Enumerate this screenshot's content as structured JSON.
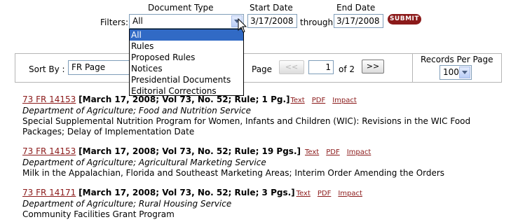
{
  "filters": {
    "label": "Filters:",
    "document_type": {
      "header": "Document Type",
      "value": "All",
      "options": [
        "All",
        "Rules",
        "Proposed Rules",
        "Notices",
        "Presidential Documents",
        "Editorial Corrections"
      ]
    },
    "start_date": {
      "header": "Start Date",
      "value": "3/17/2008"
    },
    "through_label": "through",
    "end_date": {
      "header": "End Date",
      "value": "3/17/2008"
    },
    "submit_label": "SUBMIT"
  },
  "sort": {
    "label": "Sort By :",
    "value": "FR Page"
  },
  "pagination": {
    "page_label": "Page",
    "prev_label": "<<",
    "current": "1",
    "of_label": "of 2",
    "next_label": ">>"
  },
  "records_per_page": {
    "label": "Records Per Page",
    "value": "100"
  },
  "results": [
    {
      "citation": "73 FR 14153",
      "meta": "[March 17, 2008; Vol 73, No. 52; Rule; 1 Pg.]",
      "links": [
        "Text",
        "PDF",
        "Impact"
      ],
      "agency": "Department of Agriculture; Food and Nutrition Service",
      "title": "Special Supplemental Nutrition Program for Women, Infants and Children (WIC): Revisions in the WIC Food Packages; Delay of Implementation Date"
    },
    {
      "citation": "73 FR 14153",
      "meta": "[March 17, 2008; Vol 73, No. 52; Rule; 19 Pgs.]",
      "links": [
        "Text",
        "PDF",
        "Impact"
      ],
      "agency": "Department of Agriculture; Agricultural Marketing Service",
      "title": "Milk in the Appalachian, Florida and Southeast Marketing Areas; Interim Order Amending the Orders"
    },
    {
      "citation": "73 FR 14171",
      "meta": "[March 17, 2008; Vol 73, No. 52; Rule; 3 Pgs.]",
      "links": [
        "Text",
        "PDF",
        "Impact"
      ],
      "agency": "Department of Agriculture; Rural Housing Service",
      "title": "Community Facilities Grant Program"
    }
  ]
}
